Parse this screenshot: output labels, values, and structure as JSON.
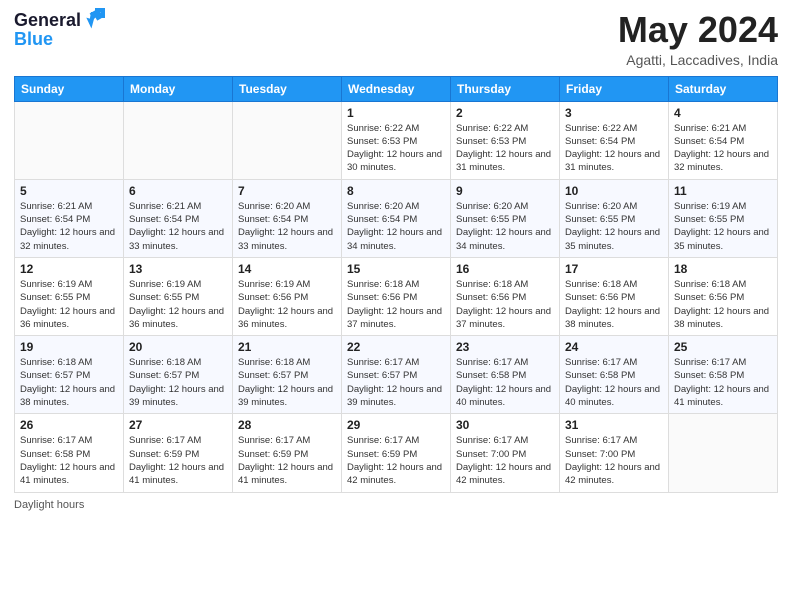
{
  "logo": {
    "line1": "General",
    "line2": "Blue",
    "arrow_color": "#2196F3"
  },
  "header": {
    "month_title": "May 2024",
    "location": "Agatti, Laccadives, India"
  },
  "days_of_week": [
    "Sunday",
    "Monday",
    "Tuesday",
    "Wednesday",
    "Thursday",
    "Friday",
    "Saturday"
  ],
  "weeks": [
    [
      {
        "day": "",
        "sunrise": "",
        "sunset": "",
        "daylight": ""
      },
      {
        "day": "",
        "sunrise": "",
        "sunset": "",
        "daylight": ""
      },
      {
        "day": "",
        "sunrise": "",
        "sunset": "",
        "daylight": ""
      },
      {
        "day": "1",
        "sunrise": "Sunrise: 6:22 AM",
        "sunset": "Sunset: 6:53 PM",
        "daylight": "Daylight: 12 hours and 30 minutes."
      },
      {
        "day": "2",
        "sunrise": "Sunrise: 6:22 AM",
        "sunset": "Sunset: 6:53 PM",
        "daylight": "Daylight: 12 hours and 31 minutes."
      },
      {
        "day": "3",
        "sunrise": "Sunrise: 6:22 AM",
        "sunset": "Sunset: 6:54 PM",
        "daylight": "Daylight: 12 hours and 31 minutes."
      },
      {
        "day": "4",
        "sunrise": "Sunrise: 6:21 AM",
        "sunset": "Sunset: 6:54 PM",
        "daylight": "Daylight: 12 hours and 32 minutes."
      }
    ],
    [
      {
        "day": "5",
        "sunrise": "Sunrise: 6:21 AM",
        "sunset": "Sunset: 6:54 PM",
        "daylight": "Daylight: 12 hours and 32 minutes."
      },
      {
        "day": "6",
        "sunrise": "Sunrise: 6:21 AM",
        "sunset": "Sunset: 6:54 PM",
        "daylight": "Daylight: 12 hours and 33 minutes."
      },
      {
        "day": "7",
        "sunrise": "Sunrise: 6:20 AM",
        "sunset": "Sunset: 6:54 PM",
        "daylight": "Daylight: 12 hours and 33 minutes."
      },
      {
        "day": "8",
        "sunrise": "Sunrise: 6:20 AM",
        "sunset": "Sunset: 6:54 PM",
        "daylight": "Daylight: 12 hours and 34 minutes."
      },
      {
        "day": "9",
        "sunrise": "Sunrise: 6:20 AM",
        "sunset": "Sunset: 6:55 PM",
        "daylight": "Daylight: 12 hours and 34 minutes."
      },
      {
        "day": "10",
        "sunrise": "Sunrise: 6:20 AM",
        "sunset": "Sunset: 6:55 PM",
        "daylight": "Daylight: 12 hours and 35 minutes."
      },
      {
        "day": "11",
        "sunrise": "Sunrise: 6:19 AM",
        "sunset": "Sunset: 6:55 PM",
        "daylight": "Daylight: 12 hours and 35 minutes."
      }
    ],
    [
      {
        "day": "12",
        "sunrise": "Sunrise: 6:19 AM",
        "sunset": "Sunset: 6:55 PM",
        "daylight": "Daylight: 12 hours and 36 minutes."
      },
      {
        "day": "13",
        "sunrise": "Sunrise: 6:19 AM",
        "sunset": "Sunset: 6:55 PM",
        "daylight": "Daylight: 12 hours and 36 minutes."
      },
      {
        "day": "14",
        "sunrise": "Sunrise: 6:19 AM",
        "sunset": "Sunset: 6:56 PM",
        "daylight": "Daylight: 12 hours and 36 minutes."
      },
      {
        "day": "15",
        "sunrise": "Sunrise: 6:18 AM",
        "sunset": "Sunset: 6:56 PM",
        "daylight": "Daylight: 12 hours and 37 minutes."
      },
      {
        "day": "16",
        "sunrise": "Sunrise: 6:18 AM",
        "sunset": "Sunset: 6:56 PM",
        "daylight": "Daylight: 12 hours and 37 minutes."
      },
      {
        "day": "17",
        "sunrise": "Sunrise: 6:18 AM",
        "sunset": "Sunset: 6:56 PM",
        "daylight": "Daylight: 12 hours and 38 minutes."
      },
      {
        "day": "18",
        "sunrise": "Sunrise: 6:18 AM",
        "sunset": "Sunset: 6:56 PM",
        "daylight": "Daylight: 12 hours and 38 minutes."
      }
    ],
    [
      {
        "day": "19",
        "sunrise": "Sunrise: 6:18 AM",
        "sunset": "Sunset: 6:57 PM",
        "daylight": "Daylight: 12 hours and 38 minutes."
      },
      {
        "day": "20",
        "sunrise": "Sunrise: 6:18 AM",
        "sunset": "Sunset: 6:57 PM",
        "daylight": "Daylight: 12 hours and 39 minutes."
      },
      {
        "day": "21",
        "sunrise": "Sunrise: 6:18 AM",
        "sunset": "Sunset: 6:57 PM",
        "daylight": "Daylight: 12 hours and 39 minutes."
      },
      {
        "day": "22",
        "sunrise": "Sunrise: 6:17 AM",
        "sunset": "Sunset: 6:57 PM",
        "daylight": "Daylight: 12 hours and 39 minutes."
      },
      {
        "day": "23",
        "sunrise": "Sunrise: 6:17 AM",
        "sunset": "Sunset: 6:58 PM",
        "daylight": "Daylight: 12 hours and 40 minutes."
      },
      {
        "day": "24",
        "sunrise": "Sunrise: 6:17 AM",
        "sunset": "Sunset: 6:58 PM",
        "daylight": "Daylight: 12 hours and 40 minutes."
      },
      {
        "day": "25",
        "sunrise": "Sunrise: 6:17 AM",
        "sunset": "Sunset: 6:58 PM",
        "daylight": "Daylight: 12 hours and 41 minutes."
      }
    ],
    [
      {
        "day": "26",
        "sunrise": "Sunrise: 6:17 AM",
        "sunset": "Sunset: 6:58 PM",
        "daylight": "Daylight: 12 hours and 41 minutes."
      },
      {
        "day": "27",
        "sunrise": "Sunrise: 6:17 AM",
        "sunset": "Sunset: 6:59 PM",
        "daylight": "Daylight: 12 hours and 41 minutes."
      },
      {
        "day": "28",
        "sunrise": "Sunrise: 6:17 AM",
        "sunset": "Sunset: 6:59 PM",
        "daylight": "Daylight: 12 hours and 41 minutes."
      },
      {
        "day": "29",
        "sunrise": "Sunrise: 6:17 AM",
        "sunset": "Sunset: 6:59 PM",
        "daylight": "Daylight: 12 hours and 42 minutes."
      },
      {
        "day": "30",
        "sunrise": "Sunrise: 6:17 AM",
        "sunset": "Sunset: 7:00 PM",
        "daylight": "Daylight: 12 hours and 42 minutes."
      },
      {
        "day": "31",
        "sunrise": "Sunrise: 6:17 AM",
        "sunset": "Sunset: 7:00 PM",
        "daylight": "Daylight: 12 hours and 42 minutes."
      },
      {
        "day": "",
        "sunrise": "",
        "sunset": "",
        "daylight": ""
      }
    ]
  ],
  "footer": {
    "note": "Daylight hours"
  }
}
